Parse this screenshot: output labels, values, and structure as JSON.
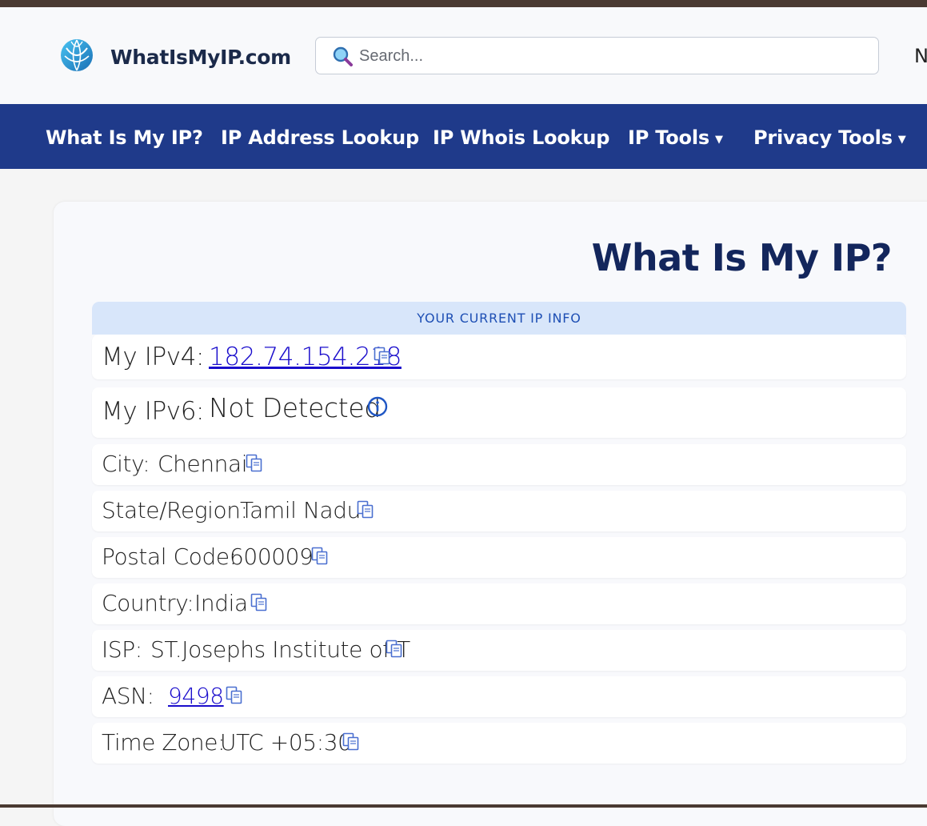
{
  "header": {
    "logo_text": "WhatIsMyIP.com",
    "search_placeholder": "Search...",
    "cut_text": "N"
  },
  "nav": {
    "items": [
      {
        "label": "What Is My IP?"
      },
      {
        "label": "IP Address Lookup"
      },
      {
        "label": "IP Whois Lookup"
      },
      {
        "label": "IP Tools",
        "dropdown": true
      },
      {
        "label": "Privacy Tools",
        "dropdown": true
      }
    ],
    "caret": "▼"
  },
  "main": {
    "title": "What Is My IP?",
    "info_header": "YOUR CURRENT IP INFO",
    "rows": {
      "ipv4": {
        "label": "My IPv4:",
        "value": "182.74.154.218"
      },
      "ipv6": {
        "label": "My IPv6:",
        "value": "Not Detected"
      },
      "city": {
        "label": "City:",
        "value": "Chennai"
      },
      "state": {
        "label": "State/Region:",
        "value": "Tamil Nadu"
      },
      "postal": {
        "label": "Postal Code:",
        "value": "600009"
      },
      "country": {
        "label": "Country:",
        "value": "India"
      },
      "isp": {
        "label": "ISP:",
        "value": "ST.Josephs Institute of T"
      },
      "asn": {
        "label": "ASN:",
        "value": "9498"
      },
      "timezone": {
        "label": "Time Zone:",
        "value": "UTC +05:30"
      }
    }
  },
  "colors": {
    "nav_bg": "#1f3a8a",
    "title": "#13265c",
    "link": "#1a0dcc",
    "info_header_bg": "#d8e6fa"
  }
}
